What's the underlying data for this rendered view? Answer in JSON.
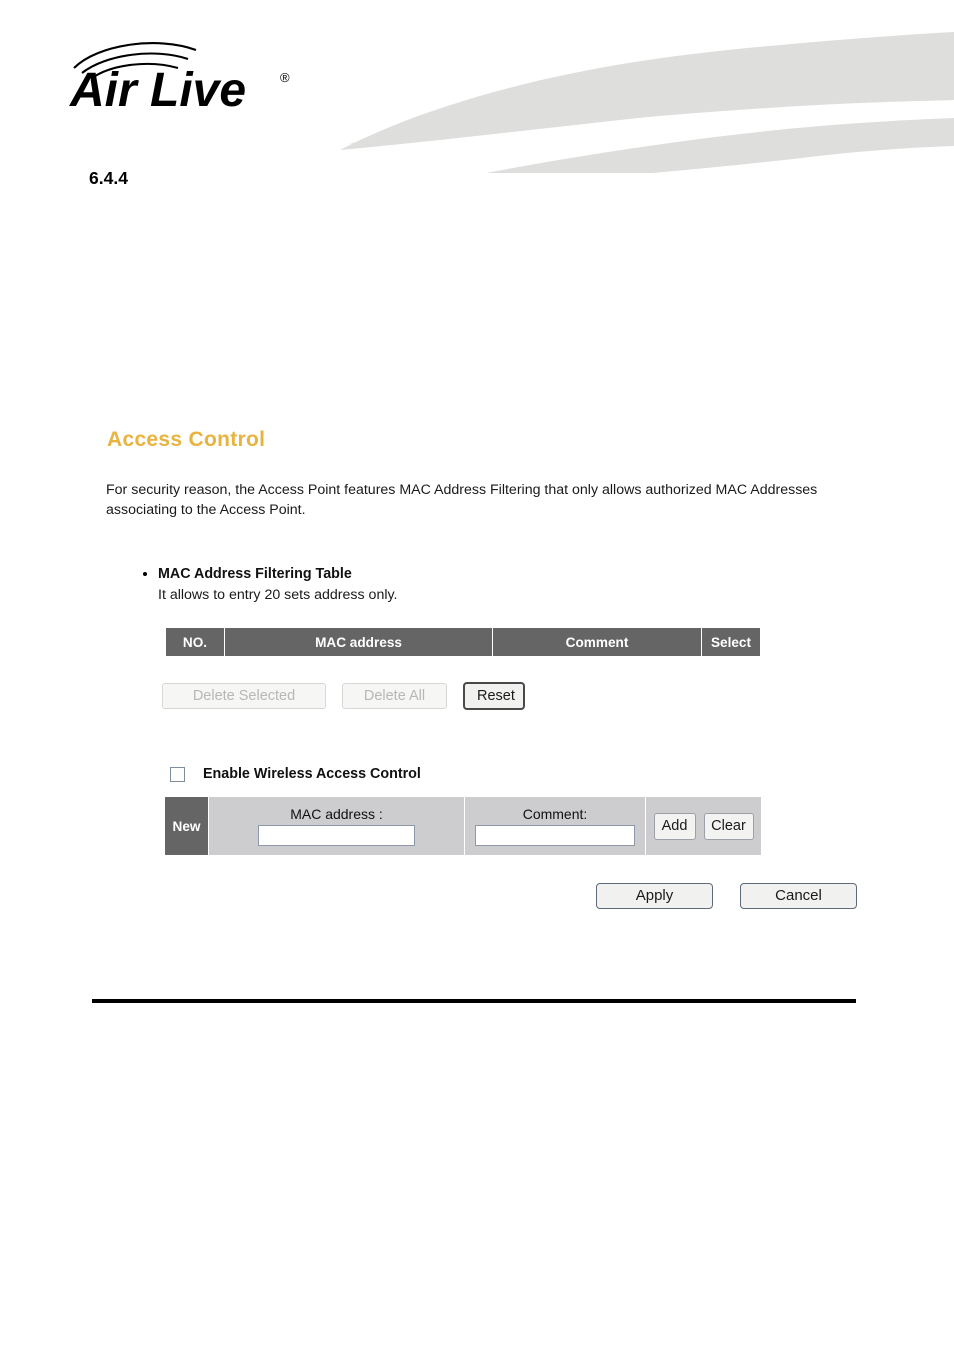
{
  "header": {
    "brand_name": "Air Live",
    "brand_registered_mark": "®",
    "swoosh_color": "#dededd",
    "logo_icon": "airlive-logo-icon"
  },
  "section": {
    "number": "6.4.4"
  },
  "panel": {
    "title": "Access Control",
    "title_color": "#e8b33f",
    "description": "For security reason, the Access Point features MAC Address Filtering that only allows authorized MAC Addresses associating to the Access Point.",
    "header_bg_color": "#666566",
    "row_bg_color": "#cdcdcf"
  },
  "filter_table_block": {
    "heading": "MAC Address Filtering Table",
    "subtext": "It allows to entry 20 sets address only."
  },
  "mac_table": {
    "columns": [
      "NO.",
      "MAC address",
      "Comment",
      "Select"
    ],
    "rows": []
  },
  "table_actions": {
    "delete_selected_label": "Delete Selected",
    "delete_selected_disabled": true,
    "delete_all_label": "Delete All",
    "delete_all_disabled": true,
    "reset_label": "Reset",
    "reset_disabled": false
  },
  "enable_acl": {
    "label": "Enable Wireless Access Control",
    "checked": false
  },
  "new_entry": {
    "row_label": "New",
    "mac_label": "MAC address :",
    "mac_value": "",
    "mac_placeholder": "",
    "comment_label": "Comment:",
    "comment_value": "",
    "comment_placeholder": "",
    "add_label": "Add",
    "clear_label": "Clear"
  },
  "form_actions": {
    "apply_label": "Apply",
    "cancel_label": "Cancel"
  }
}
